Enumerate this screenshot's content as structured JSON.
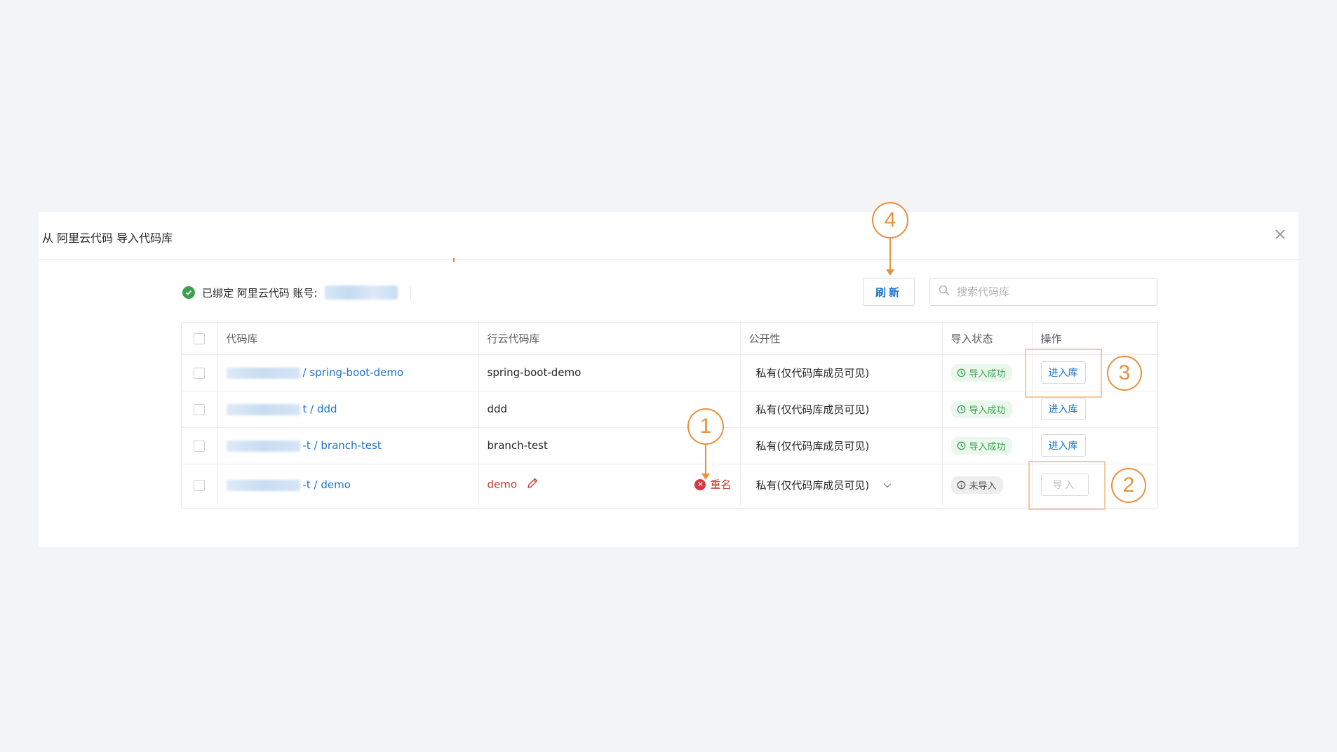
{
  "dialog": {
    "title": "从 阿里云代码 导入代码库",
    "binding": {
      "label": "已绑定 阿里云代码 账号:"
    },
    "refresh_label": "刷新",
    "search": {
      "placeholder": "搜索代码库",
      "value": ""
    }
  },
  "table": {
    "headers": [
      "代码库",
      "行云代码库",
      "公开性",
      "导入状态",
      "操作"
    ],
    "rows": [
      {
        "source_suffix": "/ spring-boot-demo",
        "target": "spring-boot-demo",
        "visibility": "私有(仅代码库成员可见)",
        "status": "导入成功",
        "action": "进入库"
      },
      {
        "source_suffix": "t / ddd",
        "target": "ddd",
        "visibility": "私有(仅代码库成员可见)",
        "status": "导入成功",
        "action": "进入库"
      },
      {
        "source_suffix": "-t / branch-test",
        "target": "branch-test",
        "visibility": "私有(仅代码库成员可见)",
        "status": "导入成功",
        "action": "进入库"
      },
      {
        "source_suffix": "-t / demo",
        "target": "demo",
        "error": "重名",
        "visibility": "私有(仅代码库成员可见)",
        "status": "未导入",
        "action": "导入"
      }
    ]
  },
  "callouts": [
    "1",
    "2",
    "3",
    "4"
  ],
  "icons": {
    "close": "close-icon",
    "bound": "check-circle-icon",
    "search": "search-icon",
    "edit": "pencil-icon",
    "error": "x-circle-icon",
    "dropdown": "chevron-down-icon",
    "status_ok": "clock-icon",
    "status_no": "info-icon"
  },
  "colors": {
    "background": "#f2f4f8",
    "link": "#1b74cc",
    "success": "#3aa14f",
    "error": "#c0392b",
    "annotation": "#e8913c"
  }
}
